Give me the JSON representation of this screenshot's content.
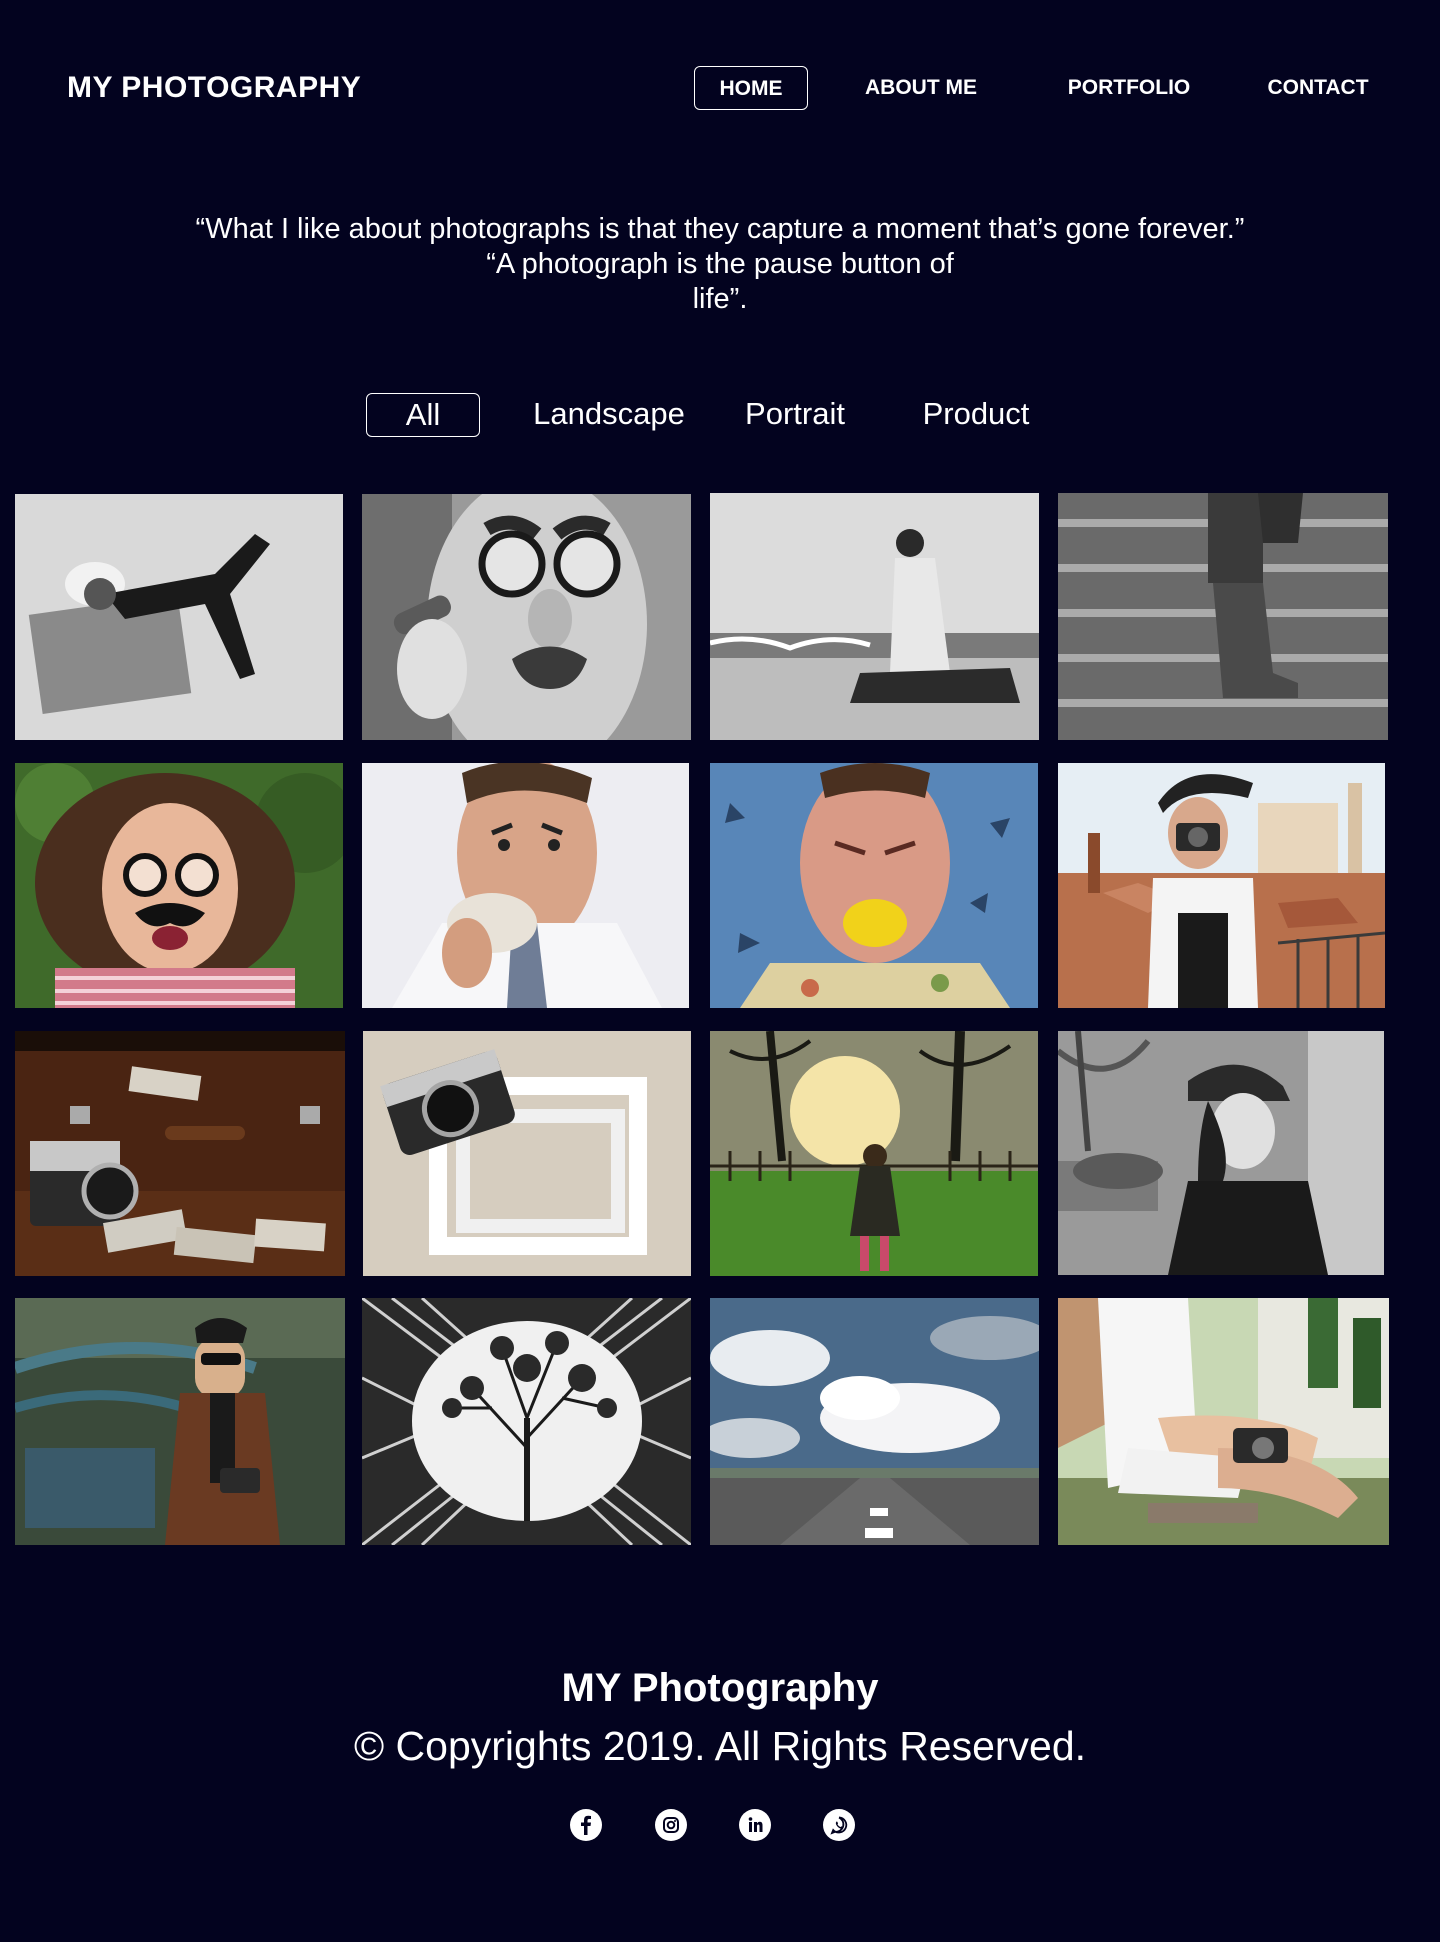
{
  "header": {
    "brand": "MY PHOTOGRAPHY",
    "nav": [
      {
        "label": "HOME",
        "active": true
      },
      {
        "label": "ABOUT ME",
        "active": false
      },
      {
        "label": "PORTFOLIO",
        "active": false
      },
      {
        "label": "CONTACT",
        "active": false
      }
    ]
  },
  "quote": {
    "line1": "“What I like about photographs is that they capture a moment that’s gone forever.”",
    "line2": "“A photograph is the pause button of",
    "line3": "life”."
  },
  "filters": [
    {
      "label": "All",
      "active": true
    },
    {
      "label": "Landscape",
      "active": false
    },
    {
      "label": "Portrait",
      "active": false
    },
    {
      "label": "Product",
      "active": false
    }
  ],
  "gallery": {
    "photos": [
      {
        "subject": "woman lying in snow (black and white)"
      },
      {
        "subject": "man with novelty glasses and mustache holding cigar"
      },
      {
        "subject": "woman sitting on beach (black and white)"
      },
      {
        "subject": "boots on stairs (black and white)"
      },
      {
        "subject": "woman with fake glasses and mustache on grass"
      },
      {
        "subject": "man eating a donut"
      },
      {
        "subject": "man biting a lemon"
      },
      {
        "subject": "woman with hat taking photo over rooftops"
      },
      {
        "subject": "vintage camera on suitcase with photos"
      },
      {
        "subject": "camera with white frame"
      },
      {
        "subject": "girl in field at sunset"
      },
      {
        "subject": "woman with cap (black and white)"
      },
      {
        "subject": "man in leather jacket with camera"
      },
      {
        "subject": "tree through spiral structure"
      },
      {
        "subject": "road under cloudy sky"
      },
      {
        "subject": "woman holding camera on bench"
      }
    ]
  },
  "footer": {
    "title": "MY Photography",
    "copyright": "© Copyrights 2019. All Rights Reserved.",
    "social": [
      {
        "icon": "facebook-icon",
        "glyph": "f"
      },
      {
        "icon": "instagram-icon",
        "glyph": ""
      },
      {
        "icon": "linkedin-icon",
        "glyph": "in"
      },
      {
        "icon": "whatsapp-icon",
        "glyph": ""
      }
    ]
  },
  "colors": {
    "background": "#03031f",
    "text": "#ffffff"
  }
}
